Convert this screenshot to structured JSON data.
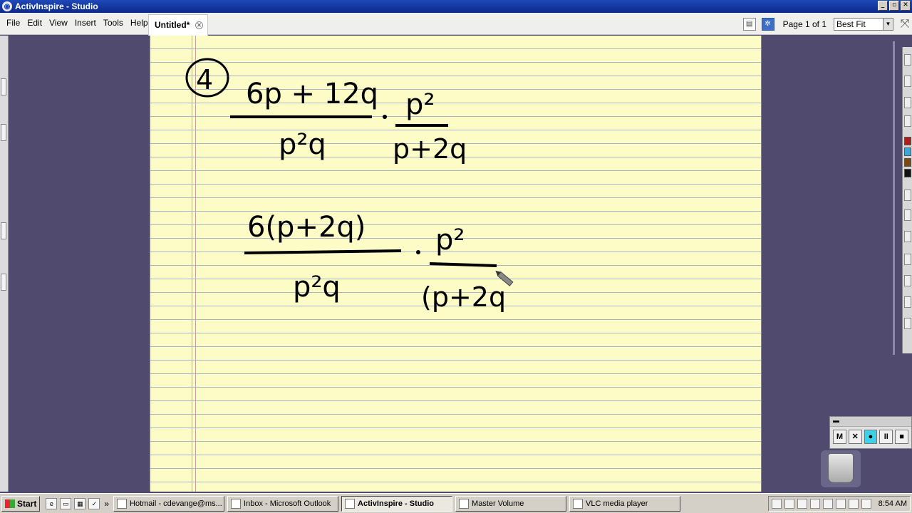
{
  "window": {
    "title": "ActivInspire - Studio",
    "buttons": [
      "_",
      "▫",
      "✕"
    ]
  },
  "menu": [
    "File",
    "Edit",
    "View",
    "Insert",
    "Tools",
    "Help"
  ],
  "document": {
    "tab_label": "Untitled*"
  },
  "toolbar": {
    "page_label": "Page 1 of 1",
    "zoom_value": "Best Fit"
  },
  "handwriting": {
    "problem_number": "4",
    "line1": {
      "numerator": "6p + 12q",
      "denominator": "p²q",
      "right_numerator": "p²",
      "right_denominator": "p+2q"
    },
    "line2": {
      "numerator": "6(p+2q)",
      "denominator": "p²q",
      "right_numerator": "p²",
      "right_denominator": "(p+2q"
    }
  },
  "recorder": {
    "buttons": [
      "M",
      "✕",
      "",
      "II",
      "■"
    ]
  },
  "taskbar": {
    "start_label": "Start",
    "tasks": [
      {
        "label": "Hotmail - cdevange@ms...",
        "active": false
      },
      {
        "label": "Inbox - Microsoft Outlook",
        "active": false
      },
      {
        "label": "ActivInspire - Studio",
        "active": true
      },
      {
        "label": "Master Volume",
        "active": false
      },
      {
        "label": "VLC media player",
        "active": false
      }
    ],
    "clock": "8:54 AM"
  },
  "colors": {
    "title_bar": "#1f48b8",
    "paper": "#fdfbc6",
    "workspace": "#4f4a6e",
    "ink": "#000000"
  }
}
